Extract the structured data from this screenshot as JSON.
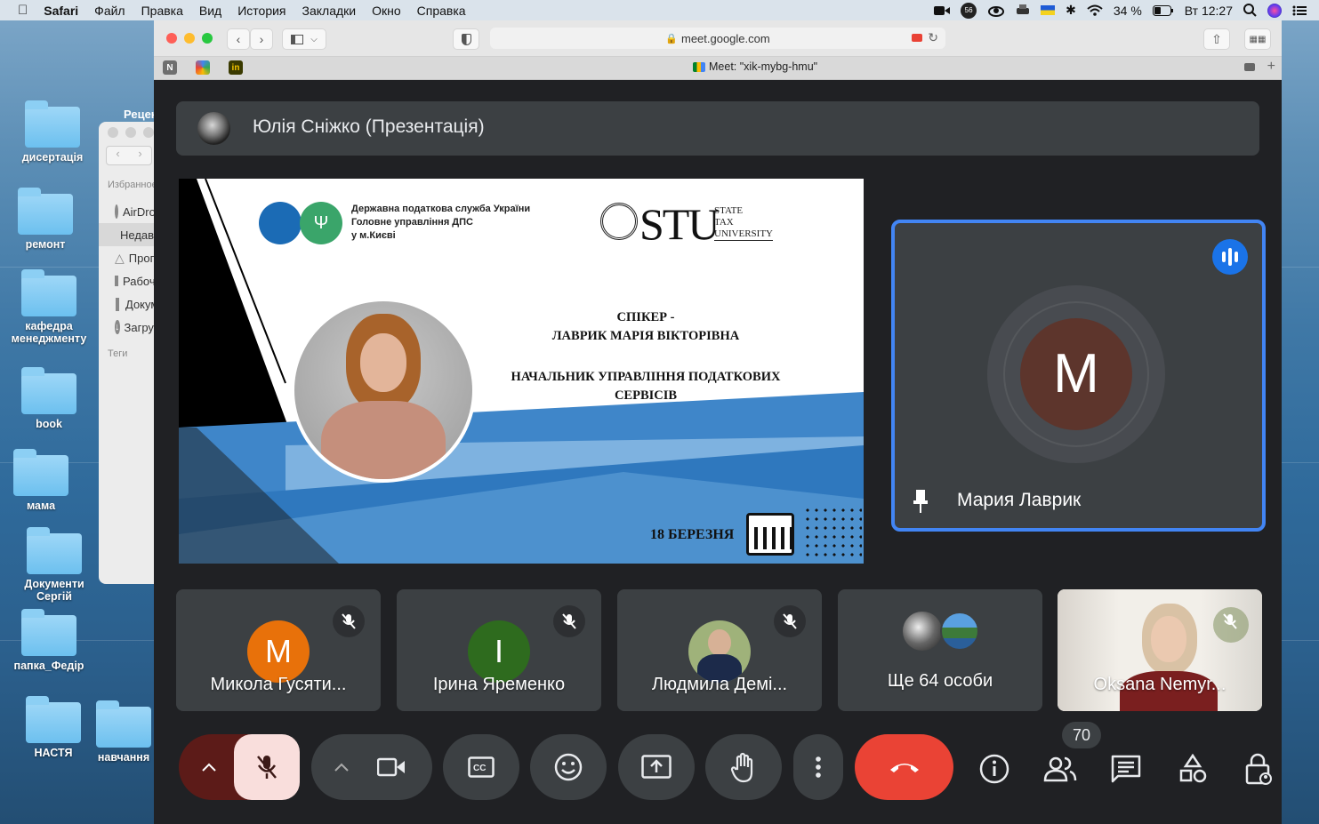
{
  "menubar": {
    "app": "Safari",
    "items": [
      "Файл",
      "Правка",
      "Вид",
      "История",
      "Закладки",
      "Окно",
      "Справка"
    ],
    "battery": "34 %",
    "clock": "Вт 12:27",
    "badge": "56"
  },
  "desktop": {
    "icons": [
      "дисертація",
      "ремонт",
      "кафедра менеджменту",
      "book",
      "мама",
      "Документи Сергій",
      "папка_Федір",
      "НАСТЯ",
      "навчання"
    ]
  },
  "finder": {
    "title": "Рецен",
    "section": "Избранное",
    "items": [
      "AirDrop",
      "Недавние",
      "Программы",
      "Рабочий стол",
      "Документы",
      "Загрузки"
    ],
    "tags": "Теги"
  },
  "browser": {
    "url": "meet.google.com",
    "tab_title": "Meet: \"xik-mybg-hmu\"",
    "fav_n": "N",
    "fav_in": "in"
  },
  "meet": {
    "presenter": "Юлія Сніжко (Презентація)",
    "slide": {
      "org_line1": "Державна податкова служба України",
      "org_line2": "Головне управління ДПС",
      "org_line3": "у м.Києві",
      "stu_big": "STU",
      "stu_small1": "STATE",
      "stu_small2": "TAX",
      "stu_small3": "UNIVERSITY",
      "speaker_label": "СПІКЕР -",
      "speaker_name": "ЛАВРИК МАРІЯ ВІКТОРІВНА",
      "speaker_role1": "НАЧАЛЬНИК УПРАВЛІННЯ ПОДАТКОВИХ",
      "speaker_role2": "СЕРВІСІВ",
      "date": "18 БЕРЕЗНЯ"
    },
    "active_speaker": {
      "initial": "M",
      "name": "Мария Лаврик"
    },
    "participants": [
      {
        "initial": "M",
        "name": "Микола Гусяти...",
        "color": "#e8710a"
      },
      {
        "initial": "I",
        "name": "Ірина Яременко",
        "color": "#2e6b1e"
      },
      {
        "initial": "",
        "name": "Людмила Демі...",
        "color": "#6d7b8a"
      },
      {
        "initial": "",
        "name": "Ще 64 особи",
        "color": ""
      },
      {
        "initial": "",
        "name": "Oksana Nemyr...",
        "color": ""
      }
    ],
    "people_count": "70",
    "colors": {
      "hangup": "#ea4335",
      "mic_off_bg": "#f9dedc",
      "accent": "#4285f4",
      "avatar_brown": "#5d352c"
    }
  }
}
